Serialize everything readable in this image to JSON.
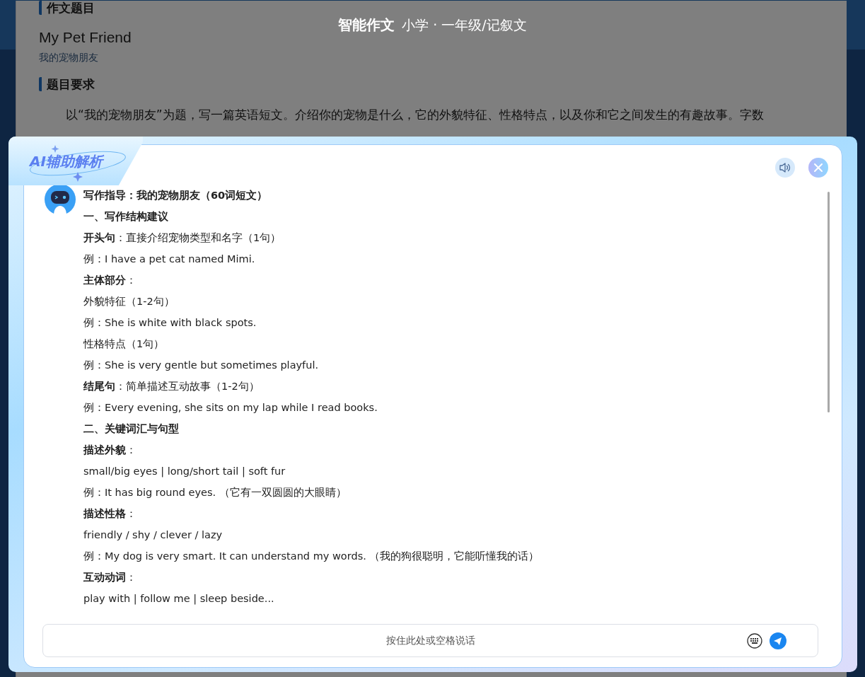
{
  "background": {
    "header_title": "智能作文",
    "header_subtitle": "小学 · 一年级/记叙文",
    "sections": [
      {
        "heading": "作文题目",
        "title": "My Pet Friend",
        "subtitle": "我的宠物朋友"
      },
      {
        "heading": "题目要求",
        "paragraph": "以“我的宠物朋友”为题，写一篇英语短文。介绍你的宠物是什么，它的外貌特征、性格特点，以及你和它之间发生的有趣故事。字数"
      }
    ]
  },
  "dialog": {
    "title": "AI辅助解析",
    "message": [
      {
        "kind": "heading",
        "text": "写作指导：我的宠物朋友（60词短文）"
      },
      {
        "kind": "heading",
        "text": "一、写作结构建议"
      },
      {
        "kind": "text",
        "text": "**开头句**：直接介绍宠物类型和名字（1句）"
      },
      {
        "kind": "text",
        "text": "例：I have a pet cat named Mimi."
      },
      {
        "kind": "text",
        "text": "**主体部分**："
      },
      {
        "kind": "text",
        "text": "外貌特征（1-2句）"
      },
      {
        "kind": "text",
        "text": "例：She is white with black spots."
      },
      {
        "kind": "text",
        "text": "性格特点（1句）"
      },
      {
        "kind": "text",
        "text": "例：She is very gentle but sometimes playful."
      },
      {
        "kind": "text",
        "text": "**结尾句**：简单描述互动故事（1-2句）"
      },
      {
        "kind": "text",
        "text": "例：Every evening, she sits on my lap while I read books."
      },
      {
        "kind": "heading",
        "text": "二、关键词汇与句型"
      },
      {
        "kind": "text",
        "text": "**描述外貌**："
      },
      {
        "kind": "text",
        "text": "small/big eyes | long/short tail | soft fur"
      },
      {
        "kind": "text",
        "text": "例：It has big round eyes. （它有一双圆圆的大眼睛）"
      },
      {
        "kind": "text",
        "text": "**描述性格**："
      },
      {
        "kind": "text",
        "text": "friendly / shy / clever / lazy"
      },
      {
        "kind": "text",
        "text": "例：My dog is very smart. It can understand my words. （我的狗很聪明，它能听懂我的话）"
      },
      {
        "kind": "text",
        "text": "**互动动词**："
      },
      {
        "kind": "text",
        "text": "play with | follow me | sleep beside..."
      }
    ],
    "voice_button": "按住此处或空格说话"
  }
}
